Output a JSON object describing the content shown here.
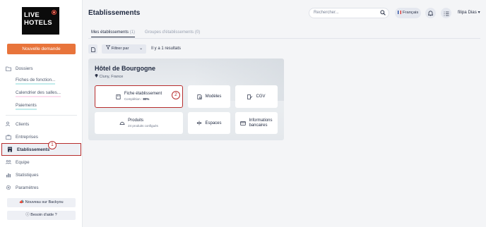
{
  "brand": {
    "line1": "LIVE",
    "line2": "HOTELS"
  },
  "sidebar": {
    "new_request": "Nouvelle demande",
    "items": [
      {
        "label": "Dossiers",
        "icon": "folder-icon"
      },
      {
        "label": "Fiches de fonction...",
        "icon": ""
      },
      {
        "label": "Calendrier des salles...",
        "icon": ""
      },
      {
        "label": "Paiements",
        "icon": ""
      },
      {
        "label": "Clients",
        "icon": "users-icon"
      },
      {
        "label": "Entreprises",
        "icon": "briefcase-icon"
      },
      {
        "label": "Etablissements",
        "icon": "building-icon"
      },
      {
        "label": "Equipe",
        "icon": "team-icon"
      },
      {
        "label": "Statistiques",
        "icon": "chart-icon"
      },
      {
        "label": "Paramètres",
        "icon": "gear-icon"
      }
    ],
    "whats_new": "Nouveau sur Backyou",
    "help": "Besoin d'aide ?"
  },
  "header": {
    "title": "Etablissements",
    "search_placeholder": "Rechercher...",
    "language": "Français",
    "user": "filipa Dias"
  },
  "tabs": [
    {
      "label": "Mes établissements",
      "count": "(1)"
    },
    {
      "label": "Groupes d'établissements",
      "count": "(0)"
    }
  ],
  "toolbar": {
    "filter_label": "Filtrer par",
    "results": "Il y a 1 resultats"
  },
  "hotel": {
    "name": "Hôtel de Bourgogne",
    "location": "Cluny, France",
    "tiles": {
      "fiche": {
        "label": "Fiche établissement",
        "sub_prefix": "Complétion :",
        "sub_value": "80%"
      },
      "modeles": "Modèles",
      "cgv": "CGV",
      "produits": {
        "label": "Produits",
        "sub": "24 produits configués"
      },
      "espaces": "Espaces",
      "infos_line1": "Informations",
      "infos_line2": "bancaires"
    }
  },
  "annotations": {
    "one": "1",
    "two": "2"
  },
  "colors": {
    "accent": "#e8743b",
    "highlight": "#b72d2d",
    "text": "#2b3348"
  }
}
